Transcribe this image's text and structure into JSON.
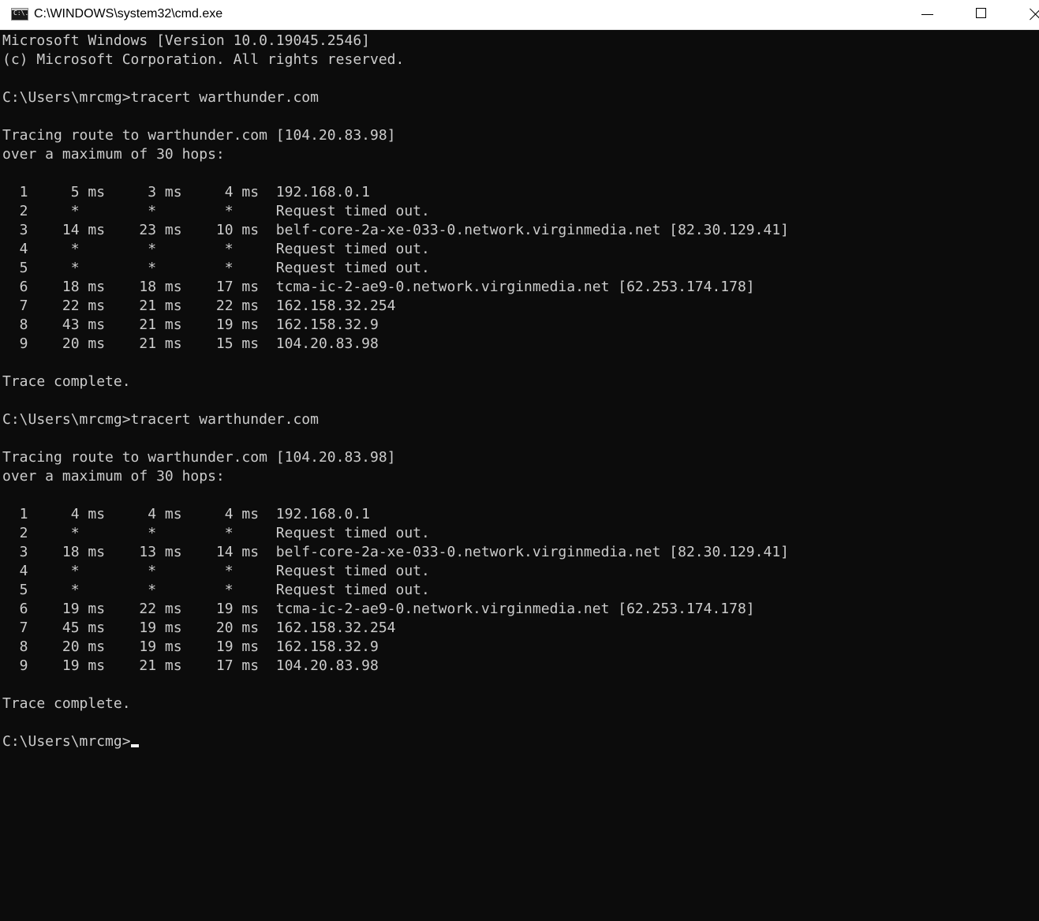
{
  "window": {
    "title": "C:\\WINDOWS\\system32\\cmd.exe",
    "icon": "cmd-icon",
    "icon_text": "C:\\."
  },
  "colors": {
    "background": "#0c0c0c",
    "foreground": "#cccccc",
    "titlebar": "#ffffff"
  },
  "console": {
    "lines": [
      "Microsoft Windows [Version 10.0.19045.2546]",
      "(c) Microsoft Corporation. All rights reserved.",
      "",
      "C:\\Users\\mrcmg>tracert warthunder.com",
      "",
      "Tracing route to warthunder.com [104.20.83.98]",
      "over a maximum of 30 hops:",
      "",
      "  1     5 ms     3 ms     4 ms  192.168.0.1",
      "  2     *        *        *     Request timed out.",
      "  3    14 ms    23 ms    10 ms  belf-core-2a-xe-033-0.network.virginmedia.net [82.30.129.41]",
      "  4     *        *        *     Request timed out.",
      "  5     *        *        *     Request timed out.",
      "  6    18 ms    18 ms    17 ms  tcma-ic-2-ae9-0.network.virginmedia.net [62.253.174.178]",
      "  7    22 ms    21 ms    22 ms  162.158.32.254",
      "  8    43 ms    21 ms    19 ms  162.158.32.9",
      "  9    20 ms    21 ms    15 ms  104.20.83.98",
      "",
      "Trace complete.",
      "",
      "C:\\Users\\mrcmg>tracert warthunder.com",
      "",
      "Tracing route to warthunder.com [104.20.83.98]",
      "over a maximum of 30 hops:",
      "",
      "  1     4 ms     4 ms     4 ms  192.168.0.1",
      "  2     *        *        *     Request timed out.",
      "  3    18 ms    13 ms    14 ms  belf-core-2a-xe-033-0.network.virginmedia.net [82.30.129.41]",
      "  4     *        *        *     Request timed out.",
      "  5     *        *        *     Request timed out.",
      "  6    19 ms    22 ms    19 ms  tcma-ic-2-ae9-0.network.virginmedia.net [62.253.174.178]",
      "  7    45 ms    19 ms    20 ms  162.158.32.254",
      "  8    20 ms    19 ms    19 ms  162.158.32.9",
      "  9    19 ms    21 ms    17 ms  104.20.83.98",
      "",
      "Trace complete.",
      ""
    ],
    "prompt": "C:\\Users\\mrcmg>"
  }
}
